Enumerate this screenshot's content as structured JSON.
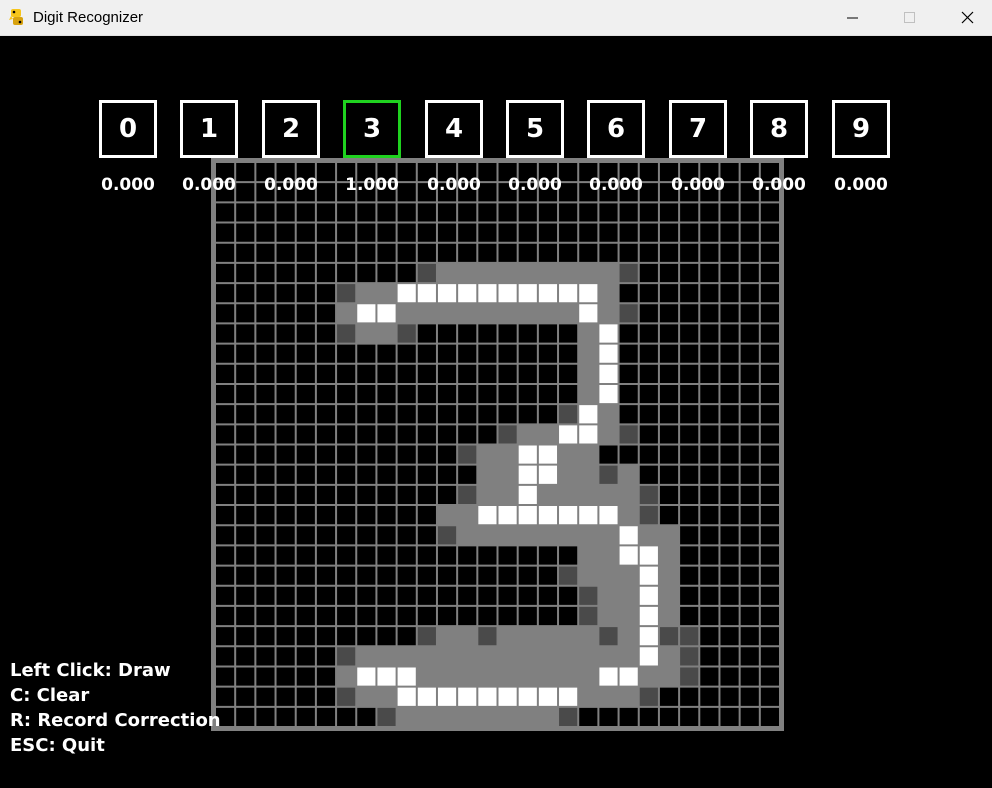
{
  "window": {
    "title": "Digit Recognizer",
    "controls": [
      "minimize",
      "maximize",
      "close"
    ]
  },
  "digits": [
    {
      "label": "0",
      "score": "0.000",
      "selected": false
    },
    {
      "label": "1",
      "score": "0.000",
      "selected": false
    },
    {
      "label": "2",
      "score": "0.000",
      "selected": false
    },
    {
      "label": "3",
      "score": "1.000",
      "selected": true
    },
    {
      "label": "4",
      "score": "0.000",
      "selected": false
    },
    {
      "label": "5",
      "score": "0.000",
      "selected": false
    },
    {
      "label": "6",
      "score": "0.000",
      "selected": false
    },
    {
      "label": "7",
      "score": "0.000",
      "selected": false
    },
    {
      "label": "8",
      "score": "0.000",
      "selected": false
    },
    {
      "label": "9",
      "score": "0.000",
      "selected": false
    }
  ],
  "canvas_grid": {
    "cols": 28,
    "rows": 28,
    "bitmap": [
      "............................",
      "............................",
      "............................",
      "............................",
      "............................",
      "..........HSSSSSSSSSH.......",
      "......HSSWWWWWWWWWWS........",
      "......SWWSSSSSSSSSWSH.......",
      "......HSSH........SW........",
      "..................SW........",
      "..................SW........",
      "..................SW........",
      ".................HWS........",
      "..............HSSWWSH.......",
      "............HSSWWSS.........",
      ".............SSWWSSHS.......",
      "............HSSWSSSSSH......",
      "...........SSWWWWWWWSH......",
      "...........HSSSSSSSSWSS.....",
      "..................SSWWS.....",
      ".................HSSSWS.....",
      "..................HSSWS.....",
      "..................HSSWS.....",
      "..........HSSHSSSSSHSWHH....",
      "......HSSSSSSSSSSSSSSWSH....",
      "......SWWWSSSSSSSSSWWSSH....",
      "......HSSWWWWWWWWWSSSH......",
      "........HSSSSSSSSH.........."
    ],
    "colors": {
      "W": "#ffffff",
      "S": "#808080",
      "H": "#4a4a4a",
      ".": "#000000"
    },
    "grid_line_color": "#808080",
    "border_color": "#808080"
  },
  "selected_color": "#1fd21f",
  "instructions": [
    "Left Click: Draw",
    "C: Clear",
    "R: Record Correction",
    "ESC: Quit"
  ]
}
